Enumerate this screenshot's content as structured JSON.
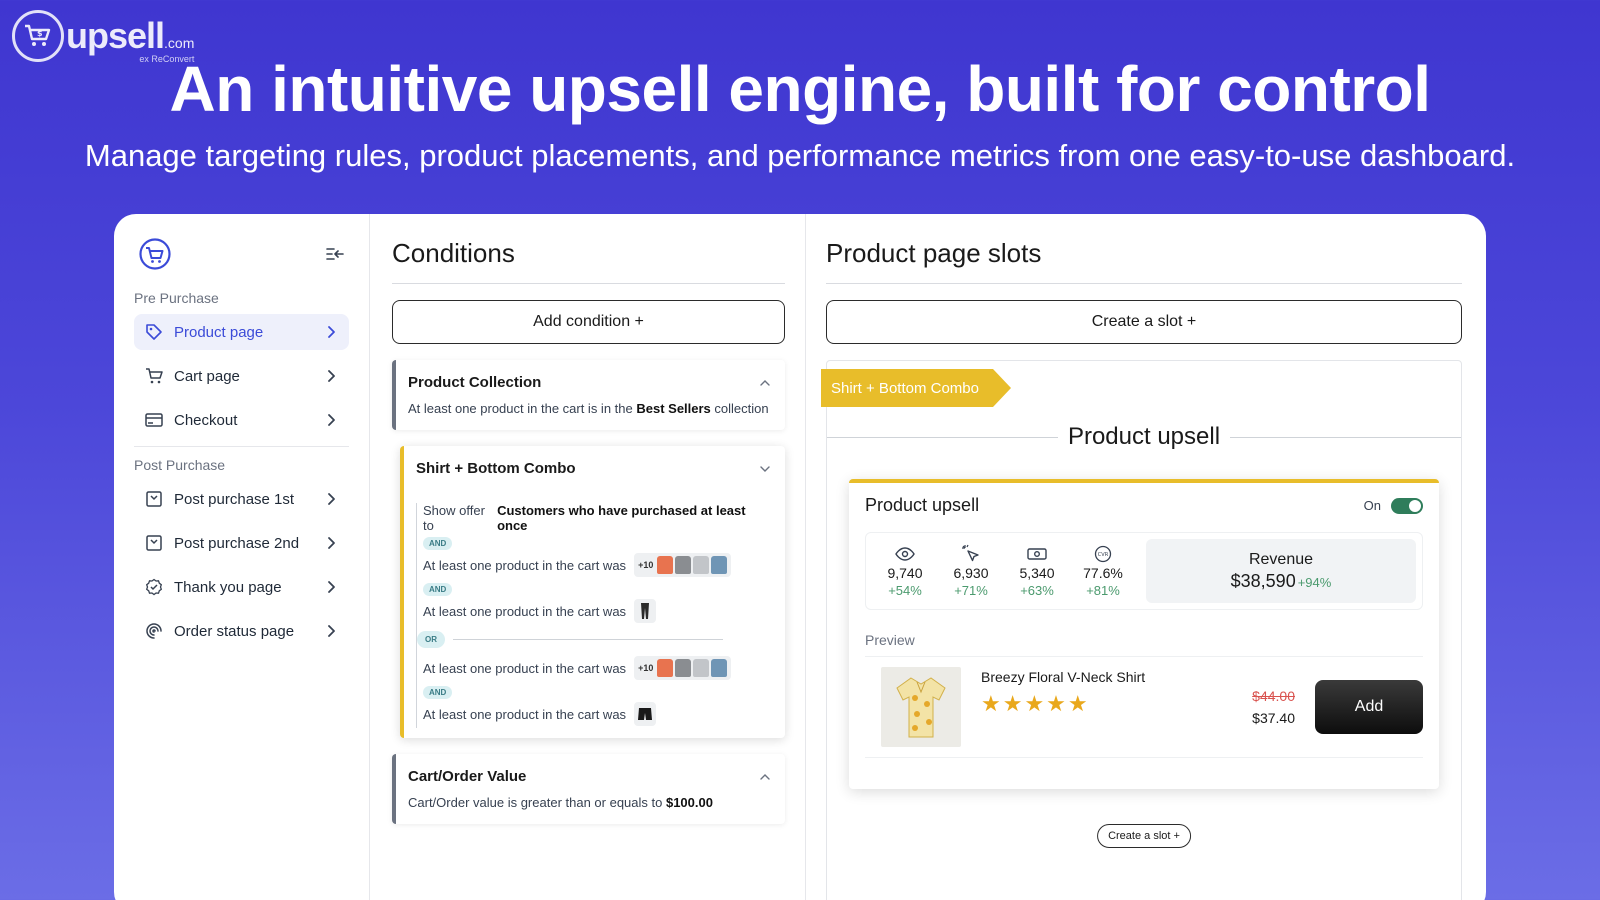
{
  "brand": {
    "name": "upsell",
    "domain": ".com",
    "sub": "ex ReConvert"
  },
  "hero": {
    "headline": "An intuitive upsell engine, built for control",
    "subline": "Manage targeting rules, product placements, and performance metrics from one easy-to-use dashboard."
  },
  "sidebar": {
    "pre_label": "Pre Purchase",
    "pre_items": [
      {
        "label": "Product page",
        "icon": "tag-icon",
        "active": true
      },
      {
        "label": "Cart page",
        "icon": "cart-icon"
      },
      {
        "label": "Checkout",
        "icon": "card-icon"
      }
    ],
    "post_label": "Post Purchase",
    "post_items": [
      {
        "label": "Post purchase 1st",
        "icon": "window-icon"
      },
      {
        "label": "Post purchase 2nd",
        "icon": "window-icon"
      },
      {
        "label": "Thank you page",
        "icon": "badge-check-icon"
      },
      {
        "label": "Order status page",
        "icon": "spiral-icon"
      }
    ]
  },
  "conditions": {
    "title": "Conditions",
    "add_label": "Add condition +",
    "card1": {
      "title": "Product Collection",
      "desc_pre": "At least one product in the cart is in the ",
      "desc_bold": "Best Sellers",
      "desc_post": " collection"
    },
    "card2": {
      "title": "Shirt + Bottom Combo",
      "offer_pre": "Show offer to ",
      "offer_bold": "Customers who have purchased at least once",
      "and_tag": "AND",
      "or_tag": "OR",
      "rule_text": "At least one product in the cart was",
      "plus_count": "+10"
    },
    "card3": {
      "title": "Cart/Order Value",
      "desc_pre": "Cart/Order value is greater than or equals to ",
      "desc_bold": "$100.00"
    }
  },
  "slots": {
    "title": "Product page slots",
    "create_label": "Create a slot +",
    "ribbon": "Shirt + Bottom Combo",
    "section_title": "Product upsell",
    "card": {
      "name": "Product upsell",
      "toggle_label": "On",
      "metrics": [
        {
          "icon": "eye-icon",
          "value": "9,740",
          "delta": "+54%"
        },
        {
          "icon": "cursor-click-icon",
          "value": "6,930",
          "delta": "+71%"
        },
        {
          "icon": "cash-icon",
          "value": "5,340",
          "delta": "+63%"
        },
        {
          "icon": "cvr-icon",
          "value": "77.6%",
          "delta": "+81%"
        }
      ],
      "revenue_label": "Revenue",
      "revenue_value": "$38,590",
      "revenue_delta": "+94%",
      "preview_label": "Preview",
      "product": {
        "name": "Breezy Floral V-Neck Shirt",
        "stars": "★★★★★",
        "old_price": "$44.00",
        "new_price": "$37.40",
        "add_label": "Add"
      }
    },
    "small_create_label": "Create a slot +"
  },
  "colors": {
    "accent_yellow": "#e8bd2a",
    "active_blue": "#3b4bd8",
    "positive_green": "#4b9a6e",
    "toggle_green": "#2f7d5b",
    "strike_red": "#d9534f"
  }
}
